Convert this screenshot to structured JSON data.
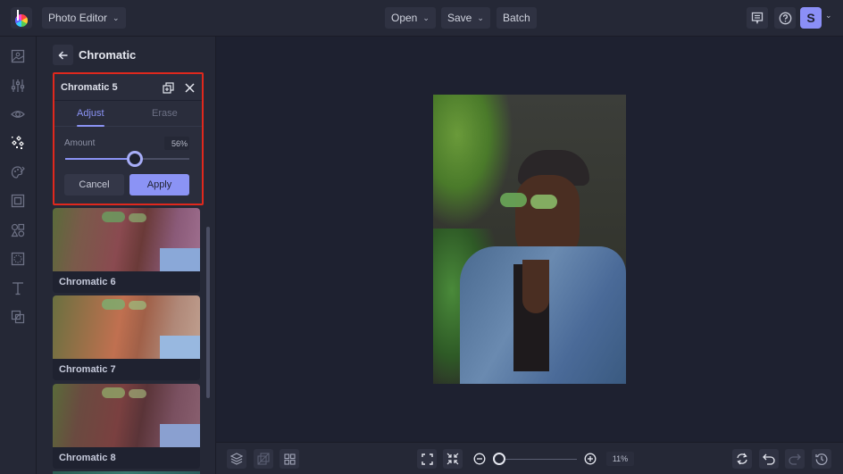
{
  "topbar": {
    "app_menu_label": "Photo Editor",
    "open_label": "Open",
    "save_label": "Save",
    "batch_label": "Batch",
    "avatar_initial": "S",
    "icons": [
      "feedback-icon",
      "help-icon",
      "chevron-down-icon"
    ]
  },
  "rail": {
    "items": [
      {
        "name": "image-icon",
        "active": false
      },
      {
        "name": "adjust-sliders-icon",
        "active": false
      },
      {
        "name": "eye-icon",
        "active": false
      },
      {
        "name": "effects-sparkle-icon",
        "active": true
      },
      {
        "name": "artsy-palette-icon",
        "active": false
      },
      {
        "name": "frame-icon",
        "active": false
      },
      {
        "name": "graphics-shapes-icon",
        "active": false
      },
      {
        "name": "overlay-texture-icon",
        "active": false
      },
      {
        "name": "text-icon",
        "active": false
      },
      {
        "name": "layers-overlap-icon",
        "active": false
      }
    ]
  },
  "panel": {
    "title": "Chromatic",
    "dialog": {
      "title": "Chromatic 5",
      "tabs": [
        {
          "label": "Adjust",
          "active": true
        },
        {
          "label": "Erase",
          "active": false
        }
      ],
      "amount_label": "Amount",
      "amount_value": "56%",
      "amount_fraction": 0.56,
      "cancel_label": "Cancel",
      "apply_label": "Apply"
    },
    "cards": [
      {
        "label": "Chromatic 6"
      },
      {
        "label": "Chromatic 7"
      },
      {
        "label": "Chromatic 8"
      }
    ]
  },
  "bottombar": {
    "zoom_value": "11%",
    "zoom_fraction": 0.0,
    "colors": {
      "accent": "#8b93f5",
      "highlight": "#e0281d"
    }
  }
}
